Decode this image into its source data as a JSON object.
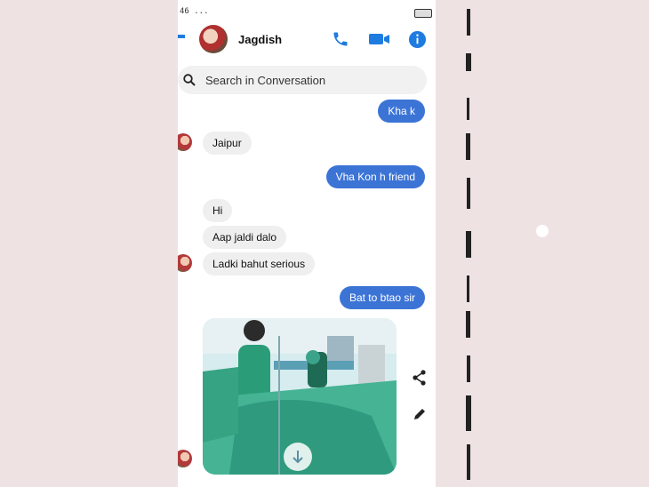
{
  "status_bar": {
    "left_text": "46 ..."
  },
  "header": {
    "contact_name": "Jagdish"
  },
  "search": {
    "placeholder": "Search in Conversation"
  },
  "messages": [
    {
      "direction": "outgoing",
      "text": "Kha k"
    },
    {
      "direction": "incoming",
      "text": "Jaipur"
    },
    {
      "direction": "outgoing",
      "text": "Vha Kon h friend"
    },
    {
      "direction": "incoming",
      "text": "Hi"
    },
    {
      "direction": "incoming",
      "text": "Aap jaldi dalo"
    },
    {
      "direction": "incoming",
      "text": "Ladki bahut serious"
    },
    {
      "direction": "outgoing",
      "text": "Bat to btao sir"
    }
  ],
  "icons": {
    "back": "back-arrow-icon",
    "call": "phone-icon",
    "video": "video-camera-icon",
    "info": "info-icon",
    "search": "search-icon",
    "share": "share-icon",
    "edit": "pencil-icon",
    "download": "download-icon"
  },
  "colors": {
    "accent": "#1e7be0",
    "outgoing_bubble": "#3c74d6",
    "incoming_bubble": "#efefef",
    "background": "#efe2e2"
  }
}
